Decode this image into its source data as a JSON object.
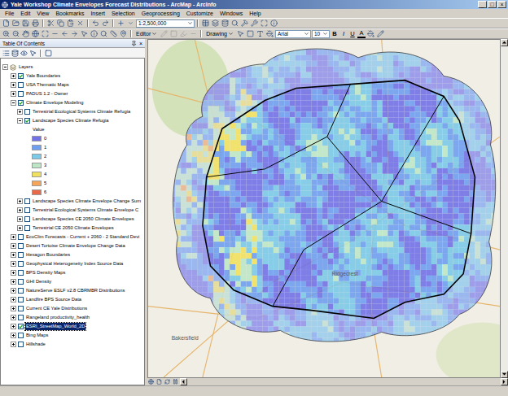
{
  "window": {
    "title": "Yale Workshop Climate Envelopes Forecast Distributions - ArcMap - ArcInfo",
    "controls": [
      "_",
      "□",
      "×"
    ]
  },
  "menu": [
    "File",
    "Edit",
    "View",
    "Bookmarks",
    "Insert",
    "Selection",
    "Geoprocessing",
    "Customize",
    "Windows",
    "Help"
  ],
  "toolbar": {
    "scale": "1:2,500,000",
    "editor": "Editor",
    "drawing": "Drawing",
    "font": "Arial",
    "size": "10",
    "format": [
      {
        "label": "B",
        "kind": "bold"
      },
      {
        "label": "I",
        "kind": "italic"
      },
      {
        "label": "U",
        "kind": "underline"
      },
      {
        "label": "A",
        "kind": "color"
      }
    ]
  },
  "toc": {
    "title": "Table Of Contents",
    "close": "×",
    "root": {
      "label": "Layers",
      "expanded": true
    },
    "layers": [
      {
        "label": "Yale Boundaries",
        "checked": true,
        "expanded": false,
        "selected": false
      },
      {
        "label": "USA Thematic Maps",
        "checked": false,
        "expanded": false,
        "selected": false
      },
      {
        "label": "PADUS 1.2 - Owner",
        "checked": false,
        "expanded": false,
        "selected": false
      },
      {
        "label": "Climate Envelope Modeling",
        "checked": true,
        "expanded": true,
        "selected": false,
        "children": [
          {
            "label": "Terrestrial Ecological Systems Climate Refugia",
            "checked": false,
            "expanded": false,
            "selected": false
          },
          {
            "label": "Landscape Species Climate Refugia",
            "checked": true,
            "expanded": true,
            "selected": false,
            "legend": {
              "heading": "Value",
              "classes": [
                {
                  "label": "0",
                  "color": "#7272e6"
                },
                {
                  "label": "1",
                  "color": "#6f9ff0"
                },
                {
                  "label": "2",
                  "color": "#7cc9e8"
                },
                {
                  "label": "3",
                  "color": "#bde6c6"
                },
                {
                  "label": "4",
                  "color": "#f0e060"
                },
                {
                  "label": "5",
                  "color": "#f4a55a"
                },
                {
                  "label": "6",
                  "color": "#e8694a"
                }
              ]
            }
          },
          {
            "label": "Landscape Species Climate Envelope Change Sum",
            "checked": false,
            "expanded": false,
            "selected": false
          },
          {
            "label": "Terrestrial Ecological Systems Climate Envelope C",
            "checked": false,
            "expanded": false,
            "selected": false
          },
          {
            "label": "Landscape Species CE 2050 Climate Envelopes",
            "checked": false,
            "expanded": false,
            "selected": false
          },
          {
            "label": "Terrestrial CE 2050 Climate Envelopes",
            "checked": false,
            "expanded": false,
            "selected": false
          }
        ]
      },
      {
        "label": "EcoClim Forecasts - Current + 2060 - 2 Standard Devi",
        "checked": false,
        "expanded": false,
        "selected": false
      },
      {
        "label": "Desert Tortoise Climate Envelope Change Data",
        "checked": false,
        "expanded": false,
        "selected": false
      },
      {
        "label": "Hexagon Boundaries",
        "checked": false,
        "expanded": false,
        "selected": false
      },
      {
        "label": "Geophysical Heterogeneity Index Source Data",
        "checked": false,
        "expanded": false,
        "selected": false
      },
      {
        "label": "BPS Density Maps",
        "checked": false,
        "expanded": false,
        "selected": false
      },
      {
        "label": "GHI Density",
        "checked": false,
        "expanded": false,
        "selected": false
      },
      {
        "label": "NatureServe ESLF v2.8 CBRMBR Distributions",
        "checked": false,
        "expanded": false,
        "selected": false
      },
      {
        "label": "Landfire BPS Source Data",
        "checked": false,
        "expanded": false,
        "selected": false
      },
      {
        "label": "Current CE Yale Distributions",
        "checked": false,
        "expanded": false,
        "selected": false
      },
      {
        "label": "Rangeland productivity_health",
        "checked": false,
        "expanded": false,
        "selected": false
      },
      {
        "label": "ESRI_StreetMap_World_2D",
        "checked": true,
        "expanded": false,
        "selected": true
      },
      {
        "label": "Bing Maps",
        "checked": false,
        "expanded": false,
        "selected": false
      },
      {
        "label": "Hillshade",
        "checked": false,
        "expanded": false,
        "selected": false
      }
    ]
  },
  "map": {
    "labels": [
      {
        "text": "Ridgecrest"
      },
      {
        "text": "Bakersfield"
      }
    ]
  }
}
